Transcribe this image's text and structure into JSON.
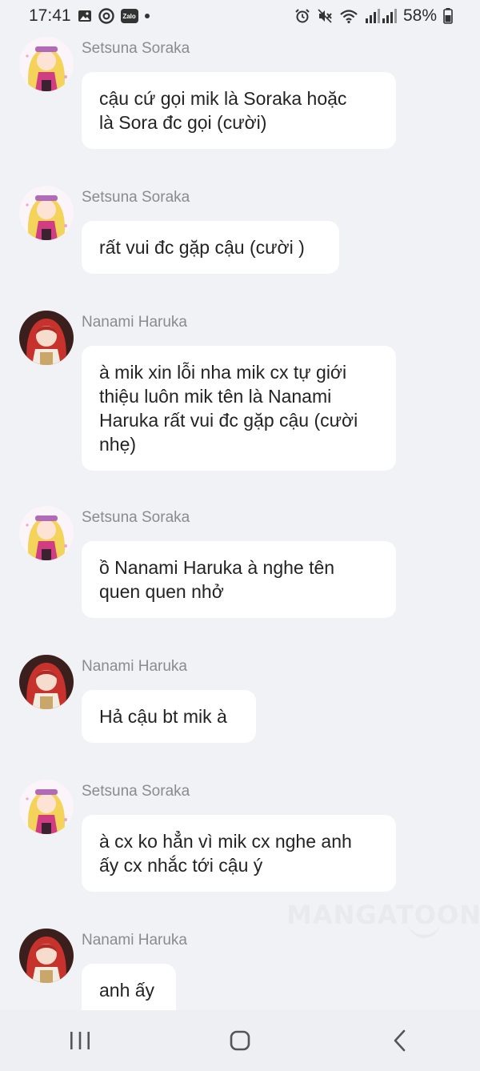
{
  "status_bar": {
    "time": "17:41",
    "battery_percent": "58%",
    "zalo_label": "Zalo",
    "left_icons": [
      "image-icon",
      "chrome-icon",
      "zalo-icon",
      "notification-dot-icon"
    ],
    "right_icons": [
      "alarm-icon",
      "mute-icon",
      "wifi-icon",
      "signal-icon",
      "battery-icon"
    ]
  },
  "messages": [
    {
      "sender": "Setsuna Soraka",
      "text": "cậu cứ gọi mik là Soraka hoặc\nlà Sora đc gọi (cười)"
    },
    {
      "sender": "Setsuna Soraka",
      "text": "rất vui đc gặp cậu (cười )"
    },
    {
      "sender": "Nanami Haruka",
      "text": "à mik xin lỗi nha mik cx tự giới\nthiệu luôn mik tên là Nanami\nHaruka rất vui đc gặp cậu (cười\nnhẹ)"
    },
    {
      "sender": "Setsuna Soraka",
      "text": "ồ Nanami Haruka à nghe tên\nquen quen nhở"
    },
    {
      "sender": "Nanami Haruka",
      "text": "Hả cậu bt mik à"
    },
    {
      "sender": "Setsuna Soraka",
      "text": "à cx ko hẳn vì mik cx nghe anh\nấy cx nhắc tới cậu ý"
    },
    {
      "sender": "Nanami Haruka",
      "text": "anh ấy"
    }
  ],
  "watermark": "MANGATOON",
  "nav_bar": {
    "icons": [
      "recent-apps-icon",
      "home-icon",
      "back-icon"
    ]
  }
}
